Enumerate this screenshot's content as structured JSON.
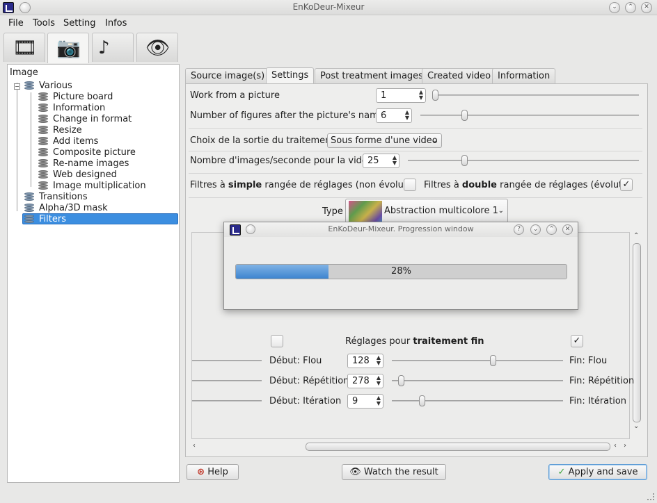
{
  "window": {
    "title": "EnKoDeur-Mixeur"
  },
  "menu": {
    "items": [
      "File",
      "Tools",
      "Setting",
      "Infos"
    ]
  },
  "toolbar": {
    "tabs": [
      {
        "icon": "film-reel-icon",
        "glyph": "🎞"
      },
      {
        "icon": "camera-icon",
        "glyph": "📷"
      },
      {
        "icon": "music-note-speaker-icon",
        "glyph": "♪"
      },
      {
        "icon": "eye-icon",
        "glyph": "👁"
      }
    ],
    "active": 1
  },
  "tree": {
    "header": "Image",
    "root_various": "Various",
    "various_children": [
      "Picture board",
      "Information",
      "Change in format",
      "Resize",
      "Add items",
      "Composite picture",
      "Re-name images",
      "Web designed",
      "Image multiplication"
    ],
    "transitions": "Transitions",
    "alpha": "Alpha/3D mask",
    "filters": "Filters",
    "selected": "Filters"
  },
  "tabs": {
    "items": [
      "Source image(s)",
      "Settings",
      "Post treatment images",
      "Created video",
      "Information"
    ],
    "active": "Settings"
  },
  "settings": {
    "work_from_picture": {
      "label": "Work from a picture",
      "value": "1"
    },
    "figures_after_name": {
      "label": "Number of figures after the picture's name",
      "value": "6"
    },
    "sortie": {
      "label": "Choix de la sortie du traitement",
      "value": "Sous forme d'une video"
    },
    "fps": {
      "label": "Nombre d'images/seconde pour la vidéo",
      "value": "25"
    },
    "filters_simple": {
      "pre": "Filtres à ",
      "bold": "simple",
      "post": " rangée de réglages (non évolutif)",
      "checked": false
    },
    "filters_double": {
      "pre": "Filtres à ",
      "bold": "double",
      "post": " rangée de réglages (évolutif)",
      "checked": true
    },
    "type": {
      "label": "Type",
      "value": "Abstraction multicolore 1"
    },
    "fine": {
      "pre": "Réglages pour ",
      "bold": "traitement fin",
      "left_checked": false,
      "right_checked": true
    },
    "rows": [
      {
        "start_label": "Début: Flou",
        "value": "128",
        "end_label": "Fin: Flou",
        "slider_level": 0.58
      },
      {
        "start_label": "Début: Répétition",
        "value": "278",
        "end_label": "Fin: Répétition",
        "slider_level": 0.02
      },
      {
        "start_label": "Début: Itération",
        "value": "9",
        "end_label": "Fin: Itération",
        "slider_level": 0.15
      }
    ]
  },
  "buttons": {
    "help": "Help",
    "watch": "Watch the result",
    "apply": "Apply and save"
  },
  "progress_dialog": {
    "title": "EnKoDeur-Mixeur. Progression window",
    "percent": 28,
    "text": "28%"
  }
}
